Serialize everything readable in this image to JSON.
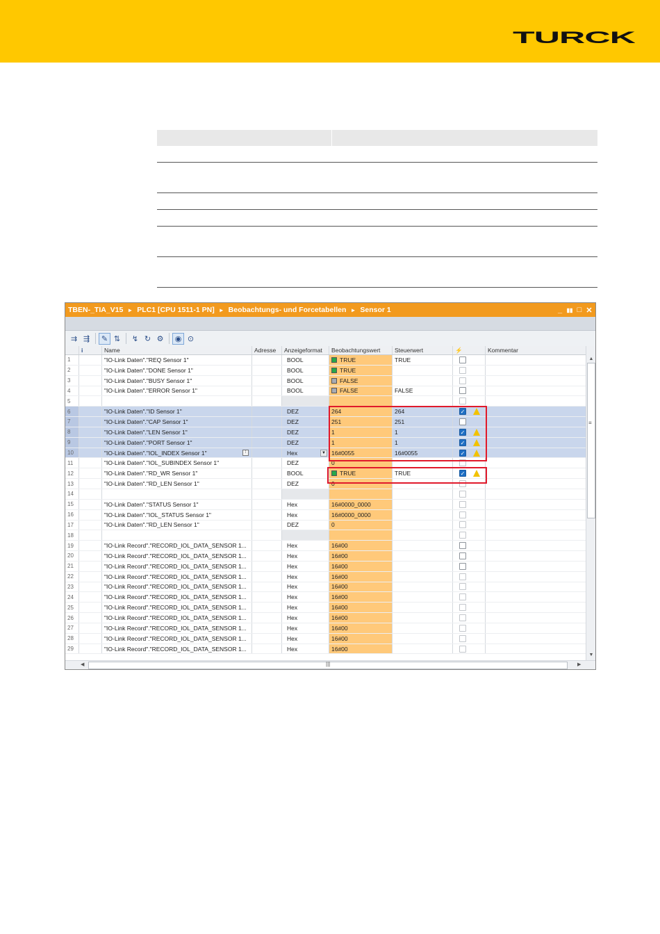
{
  "brand": {
    "logo_text": "TURCK",
    "band_color": "#ffc800"
  },
  "window": {
    "breadcrumb": [
      "TBEN-_TIA_V15",
      "PLC1 [CPU 1511-1 PN]",
      "Beobachtungs- und Forcetabellen",
      "Sensor 1"
    ],
    "controls": {
      "minimize": "_",
      "tile": "▮▮",
      "maximize": "□",
      "close": "✕"
    }
  },
  "toolbar": {
    "icons": [
      "insert-row-icon",
      "add-row-icon",
      "edit-values-icon",
      "display-format-icon",
      "modify-now-icon",
      "modify-trigger-icon",
      "enable-peripheral-icon",
      "monitor-all-icon",
      "monitor-once-icon"
    ]
  },
  "columns": {
    "no": "",
    "info": "i",
    "name": "Name",
    "address": "Adresse",
    "format": "Anzeigeformat",
    "monitor": "Beobachtungswert",
    "modify": "Steuerwert",
    "flag": "⚡",
    "comment": "Kommentar"
  },
  "rows": [
    {
      "no": "1",
      "name": "\"IO-Link Daten\".\"REQ Sensor 1\"",
      "format": "BOOL",
      "monitor": "TRUE",
      "mon_icon": "green",
      "modify": "TRUE",
      "cb": "off-gray",
      "warn": false,
      "sel": false,
      "empty": false
    },
    {
      "no": "2",
      "name": "\"IO-Link Daten\".\"DONE Sensor 1\"",
      "format": "BOOL",
      "monitor": "TRUE",
      "mon_icon": "green",
      "modify": "",
      "cb": "off",
      "warn": false,
      "sel": false,
      "empty": false
    },
    {
      "no": "3",
      "name": "\"IO-Link Daten\".\"BUSY Sensor 1\"",
      "format": "BOOL",
      "monitor": "FALSE",
      "mon_icon": "gray",
      "modify": "",
      "cb": "off",
      "warn": false,
      "sel": false,
      "empty": false
    },
    {
      "no": "4",
      "name": "\"IO-Link Daten\".\"ERROR Sensor 1\"",
      "format": "BOOL",
      "monitor": "FALSE",
      "mon_icon": "gray",
      "modify": "FALSE",
      "cb": "off-gray",
      "warn": false,
      "sel": false,
      "empty": false
    },
    {
      "no": "5",
      "name": "",
      "format": "",
      "monitor": "",
      "mon_icon": "",
      "modify": "",
      "cb": "off",
      "warn": false,
      "sel": false,
      "empty": true
    },
    {
      "no": "6",
      "name": "\"IO-Link Daten\".\"ID Sensor 1\"",
      "format": "DEZ",
      "monitor": "264",
      "mon_icon": "",
      "modify": "264",
      "cb": "on",
      "warn": true,
      "sel": true,
      "empty": false
    },
    {
      "no": "7",
      "name": "\"IO-Link Daten\".\"CAP Sensor 1\"",
      "format": "DEZ",
      "monitor": "251",
      "mon_icon": "",
      "modify": "251",
      "cb": "off-gray",
      "warn": false,
      "sel": true,
      "empty": false
    },
    {
      "no": "8",
      "name": "\"IO-Link Daten\".\"LEN Sensor 1\"",
      "format": "DEZ",
      "monitor": "1",
      "mon_icon": "",
      "modify": "1",
      "cb": "on",
      "warn": true,
      "sel": true,
      "empty": false
    },
    {
      "no": "9",
      "name": "\"IO-Link Daten\".\"PORT Sensor 1\"",
      "format": "DEZ",
      "monitor": "1",
      "mon_icon": "",
      "modify": "1",
      "cb": "on",
      "warn": true,
      "sel": true,
      "empty": false
    },
    {
      "no": "10",
      "name": "\"IO-Link Daten\".\"IOL_INDEX Sensor 1\"",
      "format": "Hex",
      "monitor": "16#0055",
      "mon_icon": "",
      "modify": "16#0055",
      "cb": "on",
      "warn": true,
      "sel": true,
      "empty": false,
      "active": true
    },
    {
      "no": "11",
      "name": "\"IO-Link Daten\".\"IOL_SUBINDEX Sensor 1\"",
      "format": "DEZ",
      "monitor": "0",
      "mon_icon": "",
      "modify": "",
      "cb": "off",
      "warn": false,
      "sel": false,
      "empty": false
    },
    {
      "no": "12",
      "name": "\"IO-Link Daten\".\"RD_WR Sensor 1\"",
      "format": "BOOL",
      "monitor": "TRUE",
      "mon_icon": "green",
      "modify": "TRUE",
      "cb": "on",
      "warn": true,
      "sel": false,
      "empty": false
    },
    {
      "no": "13",
      "name": "\"IO-Link Daten\".\"RD_LEN Sensor 1\"",
      "format": "DEZ",
      "monitor": "0",
      "mon_icon": "",
      "modify": "",
      "cb": "off",
      "warn": false,
      "sel": false,
      "empty": false
    },
    {
      "no": "14",
      "name": "",
      "format": "",
      "monitor": "",
      "mon_icon": "",
      "modify": "",
      "cb": "off",
      "warn": false,
      "sel": false,
      "empty": true
    },
    {
      "no": "15",
      "name": "\"IO-Link Daten\".\"STATUS Sensor 1\"",
      "format": "Hex",
      "monitor": "16#0000_0000",
      "mon_icon": "",
      "modify": "",
      "cb": "off",
      "warn": false,
      "sel": false,
      "empty": false
    },
    {
      "no": "16",
      "name": "\"IO-Link Daten\".\"IOL_STATUS Sensor 1\"",
      "format": "Hex",
      "monitor": "16#0000_0000",
      "mon_icon": "",
      "modify": "",
      "cb": "off",
      "warn": false,
      "sel": false,
      "empty": false
    },
    {
      "no": "17",
      "name": "\"IO-Link Daten\".\"RD_LEN Sensor 1\"",
      "format": "DEZ",
      "monitor": "0",
      "mon_icon": "",
      "modify": "",
      "cb": "off",
      "warn": false,
      "sel": false,
      "empty": false
    },
    {
      "no": "18",
      "name": "",
      "format": "",
      "monitor": "",
      "mon_icon": "",
      "modify": "",
      "cb": "off",
      "warn": false,
      "sel": false,
      "empty": true
    },
    {
      "no": "19",
      "name": "\"IO-Link Record\".\"RECORD_IOL_DATA_SENSOR 1...",
      "format": "Hex",
      "monitor": "16#00",
      "mon_icon": "",
      "modify": "",
      "cb": "off-gray",
      "warn": false,
      "sel": false,
      "empty": false
    },
    {
      "no": "20",
      "name": "\"IO-Link Record\".\"RECORD_IOL_DATA_SENSOR 1...",
      "format": "Hex",
      "monitor": "16#00",
      "mon_icon": "",
      "modify": "",
      "cb": "off-gray",
      "warn": false,
      "sel": false,
      "empty": false
    },
    {
      "no": "21",
      "name": "\"IO-Link Record\".\"RECORD_IOL_DATA_SENSOR 1...",
      "format": "Hex",
      "monitor": "16#00",
      "mon_icon": "",
      "modify": "",
      "cb": "off-gray",
      "warn": false,
      "sel": false,
      "empty": false
    },
    {
      "no": "22",
      "name": "\"IO-Link Record\".\"RECORD_IOL_DATA_SENSOR 1...",
      "format": "Hex",
      "monitor": "16#00",
      "mon_icon": "",
      "modify": "",
      "cb": "off",
      "warn": false,
      "sel": false,
      "empty": false
    },
    {
      "no": "23",
      "name": "\"IO-Link Record\".\"RECORD_IOL_DATA_SENSOR 1...",
      "format": "Hex",
      "monitor": "16#00",
      "mon_icon": "",
      "modify": "",
      "cb": "off",
      "warn": false,
      "sel": false,
      "empty": false
    },
    {
      "no": "24",
      "name": "\"IO-Link Record\".\"RECORD_IOL_DATA_SENSOR 1...",
      "format": "Hex",
      "monitor": "16#00",
      "mon_icon": "",
      "modify": "",
      "cb": "off",
      "warn": false,
      "sel": false,
      "empty": false
    },
    {
      "no": "25",
      "name": "\"IO-Link Record\".\"RECORD_IOL_DATA_SENSOR 1...",
      "format": "Hex",
      "monitor": "16#00",
      "mon_icon": "",
      "modify": "",
      "cb": "off",
      "warn": false,
      "sel": false,
      "empty": false
    },
    {
      "no": "26",
      "name": "\"IO-Link Record\".\"RECORD_IOL_DATA_SENSOR 1...",
      "format": "Hex",
      "monitor": "16#00",
      "mon_icon": "",
      "modify": "",
      "cb": "off",
      "warn": false,
      "sel": false,
      "empty": false
    },
    {
      "no": "27",
      "name": "\"IO-Link Record\".\"RECORD_IOL_DATA_SENSOR 1...",
      "format": "Hex",
      "monitor": "16#00",
      "mon_icon": "",
      "modify": "",
      "cb": "off",
      "warn": false,
      "sel": false,
      "empty": false
    },
    {
      "no": "28",
      "name": "\"IO-Link Record\".\"RECORD_IOL_DATA_SENSOR 1...",
      "format": "Hex",
      "monitor": "16#00",
      "mon_icon": "",
      "modify": "",
      "cb": "off",
      "warn": false,
      "sel": false,
      "empty": false
    },
    {
      "no": "29",
      "name": "\"IO-Link Record\".\"RECORD_IOL_DATA_SENSOR 1...",
      "format": "Hex",
      "monitor": "16#00",
      "mon_icon": "",
      "modify": "",
      "cb": "off",
      "warn": false,
      "sel": false,
      "empty": false
    }
  ],
  "scrollbar": {
    "grip": "≡",
    "h_grip": "|||"
  }
}
